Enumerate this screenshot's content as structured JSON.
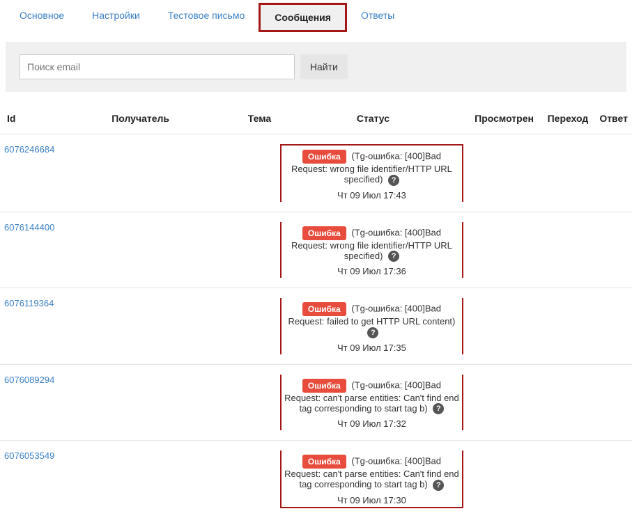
{
  "tabs": [
    {
      "label": "Основное",
      "active": false
    },
    {
      "label": "Настройки",
      "active": false
    },
    {
      "label": "Тестовое письмо",
      "active": false
    },
    {
      "label": "Сообщения",
      "active": true
    },
    {
      "label": "Ответы",
      "active": false
    }
  ],
  "search": {
    "placeholder": "Поиск email",
    "button": "Найти"
  },
  "columns": {
    "id": "Id",
    "recipient": "Получатель",
    "subject": "Тема",
    "status": "Статус",
    "viewed": "Просмотрен",
    "click": "Переход",
    "reply": "Ответ"
  },
  "badge": "Ошибка",
  "rows": [
    {
      "id": "6076246684",
      "msg": "(Tg-ошибка: [400]Bad Request: wrong file identifier/HTTP URL specified)",
      "ts": "Чт 09 Июл 17:43"
    },
    {
      "id": "6076144400",
      "msg": "(Tg-ошибка: [400]Bad Request: wrong file identifier/HTTP URL specified)",
      "ts": "Чт 09 Июл 17:36"
    },
    {
      "id": "6076119364",
      "msg": "(Tg-ошибка: [400]Bad Request: failed to get HTTP URL content)",
      "ts": "Чт 09 Июл 17:35"
    },
    {
      "id": "6076089294",
      "msg": "(Tg-ошибка: [400]Bad Request: can't parse entities: Can't find end tag corresponding to start tag b)",
      "ts": "Чт 09 Июл 17:32"
    },
    {
      "id": "6076053549",
      "msg": "(Tg-ошибка: [400]Bad Request: can't parse entities: Can't find end tag corresponding to start tag b)",
      "ts": "Чт 09 Июл 17:30"
    }
  ]
}
